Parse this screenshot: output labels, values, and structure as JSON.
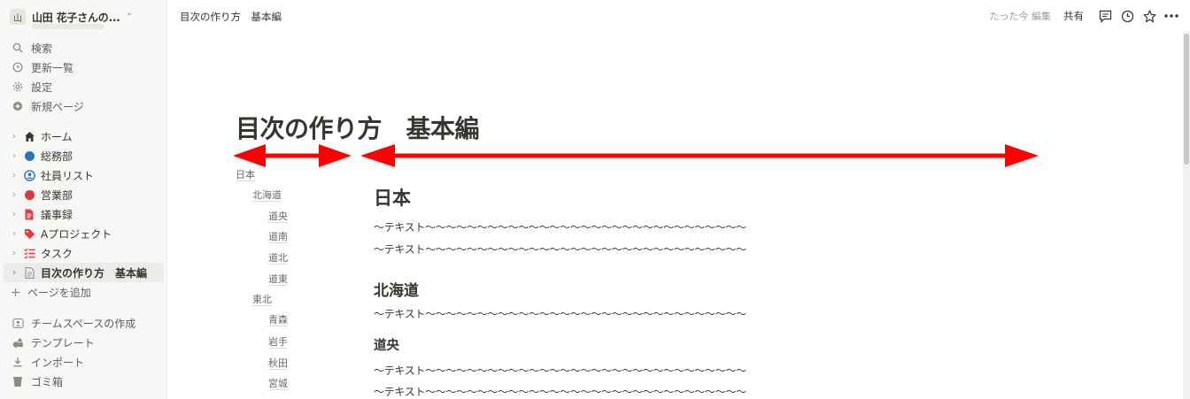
{
  "workspace": {
    "avatar": "山",
    "name": "山田 花子さんの..."
  },
  "nav": {
    "search": "検索",
    "updates": "更新一覧",
    "settings": "設定",
    "new_page": "新規ページ"
  },
  "pages": [
    {
      "label": "ホーム",
      "icon": "home-icon"
    },
    {
      "label": "総務部",
      "icon": "blue-circle-icon",
      "color": "#2e75b6"
    },
    {
      "label": "社員リスト",
      "icon": "person-circle-icon",
      "color": "#2e75b6"
    },
    {
      "label": "営業部",
      "icon": "red-circle-icon",
      "color": "#d9383d"
    },
    {
      "label": "議事録",
      "icon": "document-icon",
      "color": "#e03e3e"
    },
    {
      "label": "Aプロジェクト",
      "icon": "tag-icon",
      "color": "#e03e3e"
    },
    {
      "label": "タスク",
      "icon": "checklist-icon",
      "color": "#e03e3e"
    },
    {
      "label": "目次の作り方　基本編",
      "icon": "page-icon",
      "active": true
    }
  ],
  "add_page": "ページを追加",
  "bottom": {
    "teamspace": "チームスペースの作成",
    "templates": "テンプレート",
    "import": "インポート",
    "trash": "ゴミ箱"
  },
  "topbar": {
    "breadcrumb": "目次の作り方　基本編",
    "edited": "たった今 編集",
    "share": "共有"
  },
  "page": {
    "title": "目次の作り方　基本編",
    "toc": [
      "日本",
      "北海道",
      "道央",
      "道南",
      "道北",
      "道東",
      "東北",
      "青森",
      "岩手",
      "秋田",
      "宮城"
    ],
    "heading1": "日本",
    "heading2": "北海道",
    "heading3": "道央",
    "para": "〜テキスト〜〜〜〜〜〜〜〜〜〜〜〜〜〜〜〜〜〜〜〜〜〜〜〜〜〜〜〜〜〜〜"
  },
  "colors": {
    "accent_red": "#ff0000",
    "sidebar_bg": "#f7f7f5"
  }
}
